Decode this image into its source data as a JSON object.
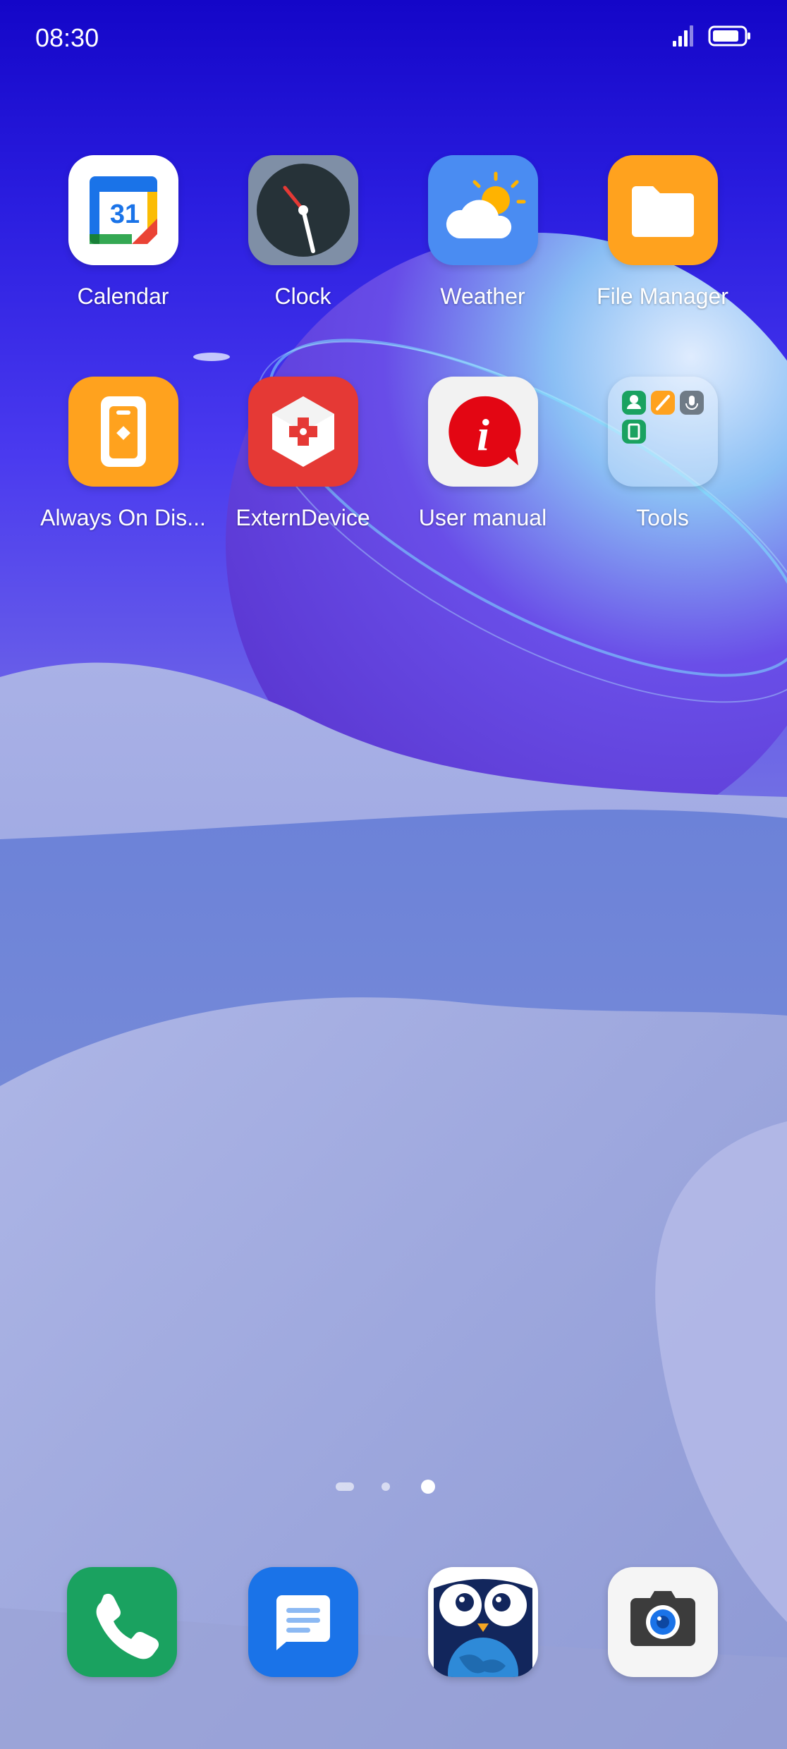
{
  "status_bar": {
    "time": "08:30",
    "icons": [
      "signal-icon",
      "battery-icon"
    ]
  },
  "home_apps": [
    {
      "label": "Calendar",
      "icon": "calendar-icon"
    },
    {
      "label": "Clock",
      "icon": "clock-icon"
    },
    {
      "label": "Weather",
      "icon": "weather-icon"
    },
    {
      "label": "File Manager",
      "icon": "folder-icon"
    },
    {
      "label": "Always On Dis...",
      "icon": "always-on-display-icon"
    },
    {
      "label": "ExternDevice",
      "icon": "gamepad-icon"
    },
    {
      "label": "User manual",
      "icon": "info-icon"
    },
    {
      "label": "Tools",
      "icon": "folder-group-icon"
    }
  ],
  "tools_folder_contents": [
    "contacts-icon",
    "notes-icon",
    "recorder-icon",
    "sim-toolkit-icon"
  ],
  "page_indicator": {
    "pages": [
      "feed",
      "page",
      "page"
    ],
    "active_index": 2
  },
  "dock": [
    {
      "icon": "phone-icon"
    },
    {
      "icon": "messages-icon"
    },
    {
      "icon": "owl-browser-icon"
    },
    {
      "icon": "camera-icon"
    }
  ],
  "colors": {
    "phone_green": "#1aa260",
    "messages_blue": "#1a73e8",
    "weather_blue": "#4a8cf2",
    "file_orange": "#ffa21e",
    "extern_red": "#e53935",
    "info_red": "#e30613"
  }
}
